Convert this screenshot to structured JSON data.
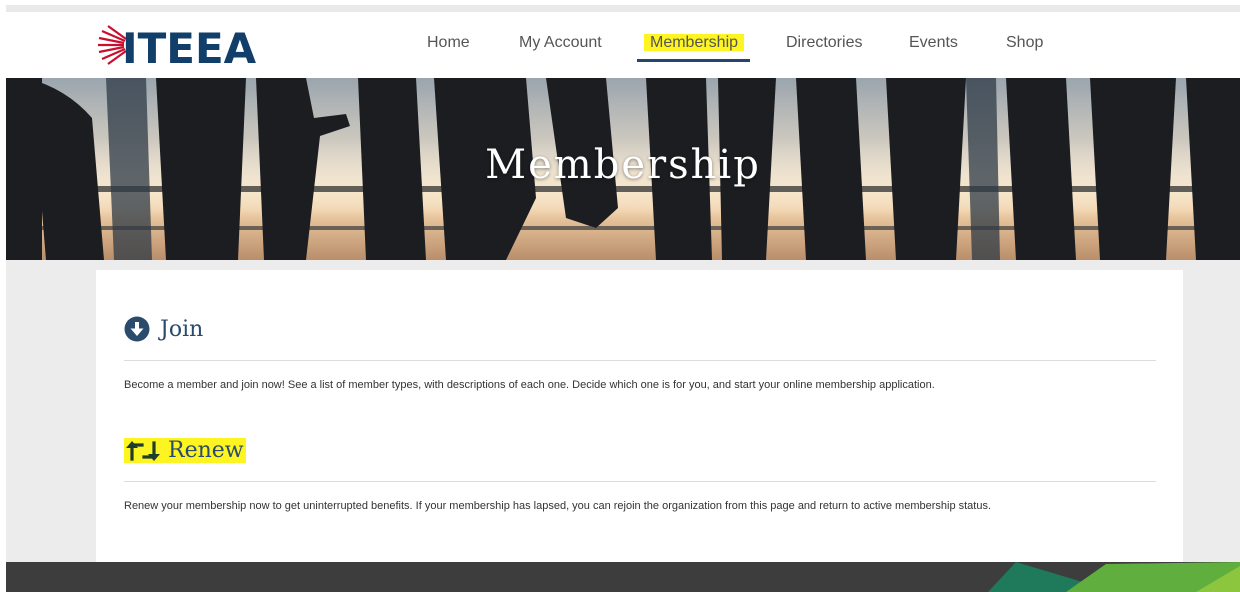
{
  "brand": {
    "logo_text": "ITEEA",
    "colors": {
      "logo_blue": "#123e6a",
      "logo_red": "#c8102e",
      "title_blue": "#2a4b6c",
      "highlight": "#fdf421",
      "nav_underline": "#25456e"
    }
  },
  "nav": {
    "items": [
      {
        "label": "Home"
      },
      {
        "label": "My Account"
      },
      {
        "label": "Membership"
      },
      {
        "label": "Directories"
      },
      {
        "label": "Events"
      },
      {
        "label": "Shop"
      }
    ],
    "active": "Membership"
  },
  "hero": {
    "title": "Membership"
  },
  "sections": {
    "join": {
      "icon": "arrow-down-circle-icon",
      "title": "Join",
      "text": "Become a member and join now! See a list of member types, with descriptions of each one. Decide which one is for you, and start your online membership application."
    },
    "renew": {
      "icon": "retweet-icon",
      "title": "Renew",
      "text": "Renew your membership now to get uninterrupted benefits. If your membership has lapsed, you can rejoin the organization from this page and return to active membership status."
    }
  },
  "footer": {
    "accent_colors": [
      "#1e7a5a",
      "#5fae3e",
      "#8cc63f"
    ]
  }
}
